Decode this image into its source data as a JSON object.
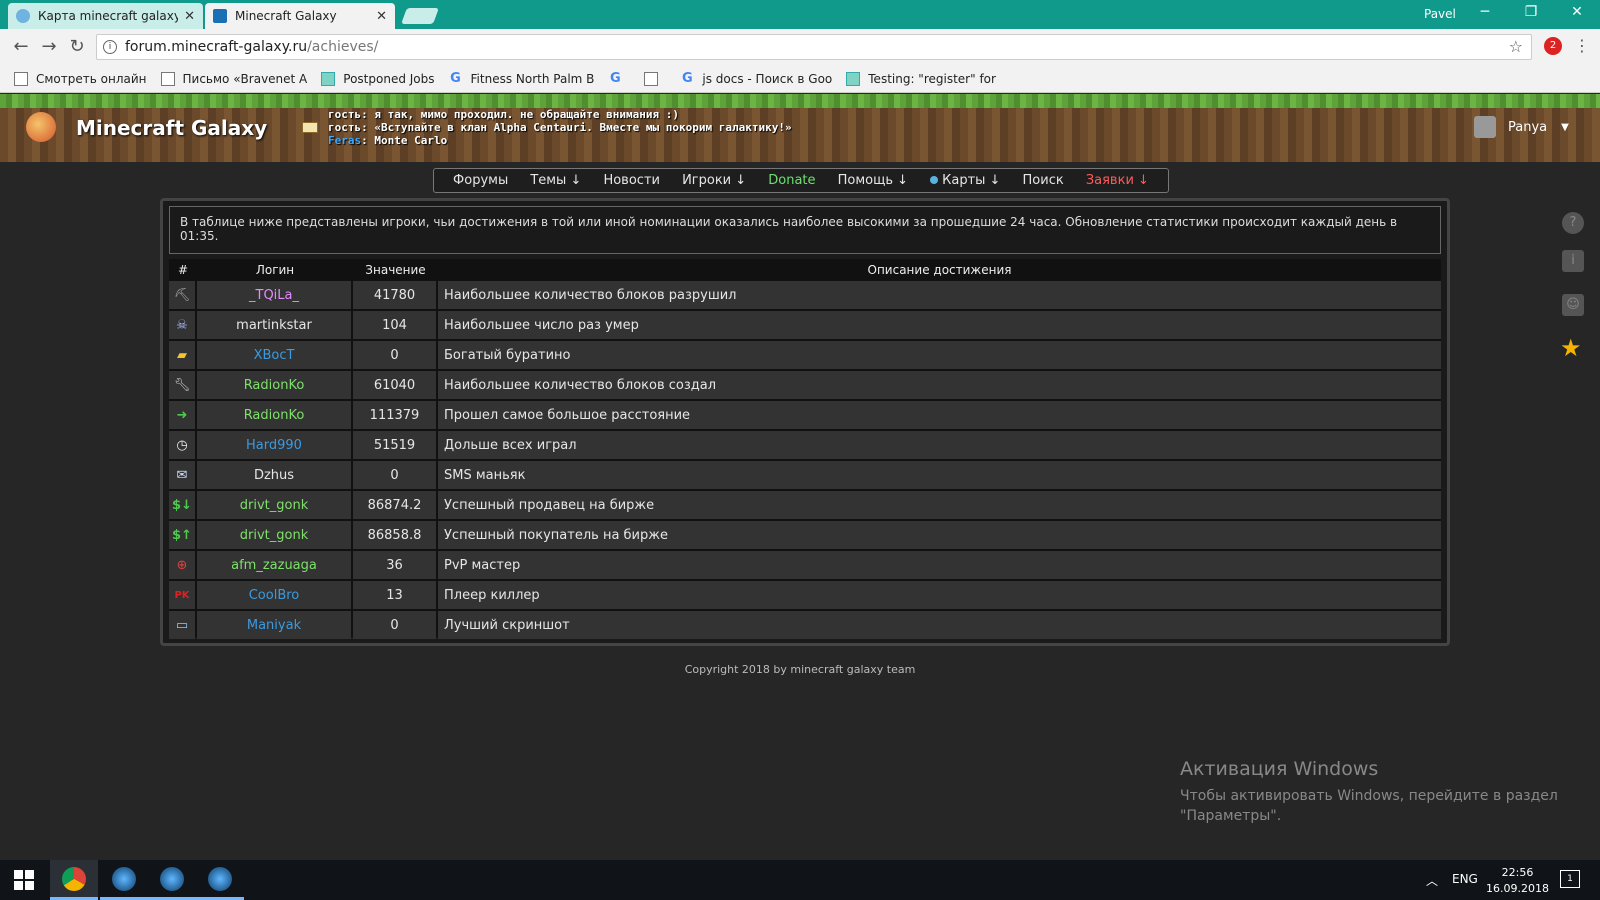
{
  "browser": {
    "tabs": [
      {
        "title": "Карта minecraft galaxy",
        "active": false
      },
      {
        "title": "Minecraft Galaxy",
        "active": true
      }
    ],
    "window_user": "Pavel",
    "url_domain": "forum.minecraft-galaxy.ru",
    "url_path": "/achieves/",
    "extension_badge": "2",
    "bookmarks": [
      {
        "label": "Смотреть онлайн",
        "icon": "page-icon"
      },
      {
        "label": "Письмо «Bravenet A",
        "icon": "page-icon"
      },
      {
        "label": "Postponed Jobs",
        "icon": "tile-icon"
      },
      {
        "label": "Fitness North Palm B",
        "icon": "google-icon"
      },
      {
        "label": "",
        "icon": "google-icon"
      },
      {
        "label": "",
        "icon": "page-icon"
      },
      {
        "label": "js docs - Поиск в Goo",
        "icon": "google-icon"
      },
      {
        "label": "Testing: \"register\" for",
        "icon": "tile-icon"
      }
    ]
  },
  "site": {
    "name": "Minecraft Galaxy",
    "chat": [
      {
        "nick": "",
        "text": "гость: я так, мимо проходил. не обращайте внимания :)"
      },
      {
        "nick": "",
        "text": "гость: «Вступайте в клан Alpha Centauri. Вместе мы покорим галактику!»"
      },
      {
        "nick": "Feras",
        "text": ": Monte Carlo"
      }
    ],
    "username": "Panya"
  },
  "nav": [
    {
      "label": "Форумы"
    },
    {
      "label": "Темы ↓"
    },
    {
      "label": "Новости"
    },
    {
      "label": "Игроки ↓"
    },
    {
      "label": "Donate"
    },
    {
      "label": "Помощь ↓"
    },
    {
      "label": "Карты ↓"
    },
    {
      "label": "Поиск"
    },
    {
      "label": "Заявки ↓"
    }
  ],
  "intro": "В таблице ниже представлены игроки, чьи достижения в той или иной номинации оказались наиболее высокими за прошедшие 24 часа. Обновление статистики происходит каждый день в 01:35.",
  "table": {
    "headers": [
      "#",
      "Логин",
      "Значение",
      "Описание достижения"
    ],
    "rows": [
      {
        "icon": "pickaxe-icon",
        "login": "_TQiLa_",
        "login_color": "pink",
        "value": "41780",
        "desc": "Наибольшее количество блоков разрушил"
      },
      {
        "icon": "dead-player-icon",
        "login": "martinkstar",
        "login_color": "white",
        "value": "104",
        "desc": "Наибольшее число раз умер"
      },
      {
        "icon": "gold-icon",
        "login": "XBocT",
        "login_color": "blue",
        "value": "0",
        "desc": "Богатый буратино"
      },
      {
        "icon": "wrench-icon",
        "login": "RadionKo",
        "login_color": "green",
        "value": "61040",
        "desc": "Наибольшее количество блоков создал"
      },
      {
        "icon": "arrow-right-icon",
        "login": "RadionKo",
        "login_color": "green",
        "value": "111379",
        "desc": "Прошел самое большое расстояние"
      },
      {
        "icon": "clock-icon",
        "login": "Hard990",
        "login_color": "blue",
        "value": "51519",
        "desc": "Дольше всех играл"
      },
      {
        "icon": "envelope-icon",
        "login": "Dzhus",
        "login_color": "white",
        "value": "0",
        "desc": "SMS маньяк"
      },
      {
        "icon": "dollar-down-icon",
        "login": "drivt_gonk",
        "login_color": "green",
        "value": "86874.2",
        "desc": "Успешный продавец на бирже"
      },
      {
        "icon": "dollar-up-icon",
        "login": "drivt_gonk",
        "login_color": "green",
        "value": "86858.8",
        "desc": "Успешный покупатель на бирже"
      },
      {
        "icon": "target-icon",
        "login": "afm_zazuaga",
        "login_color": "green",
        "value": "36",
        "desc": "PvP мастер"
      },
      {
        "icon": "pk-icon",
        "login": "CoolBro",
        "login_color": "blue",
        "value": "13",
        "desc": "Плеер киллер"
      },
      {
        "icon": "screenshot-icon",
        "login": "Maniyak",
        "login_color": "blue",
        "value": "0",
        "desc": "Лучший скриншот"
      }
    ]
  },
  "copyright": "Copyright 2018 by minecraft galaxy team",
  "activation": {
    "title": "Активация Windows",
    "text_line1": "Чтобы активировать Windows, перейдите в раздел",
    "text_line2": "\"Параметры\"."
  },
  "taskbar": {
    "lang": "ENG",
    "time": "22:56",
    "date": "16.09.2018",
    "notifications": "1"
  },
  "colors": {
    "pink": "#e58bff",
    "blue": "#3a9be0",
    "green": "#7ee06a",
    "white": "#e6e6e6",
    "chrome_teal": "#0f9a8c"
  }
}
